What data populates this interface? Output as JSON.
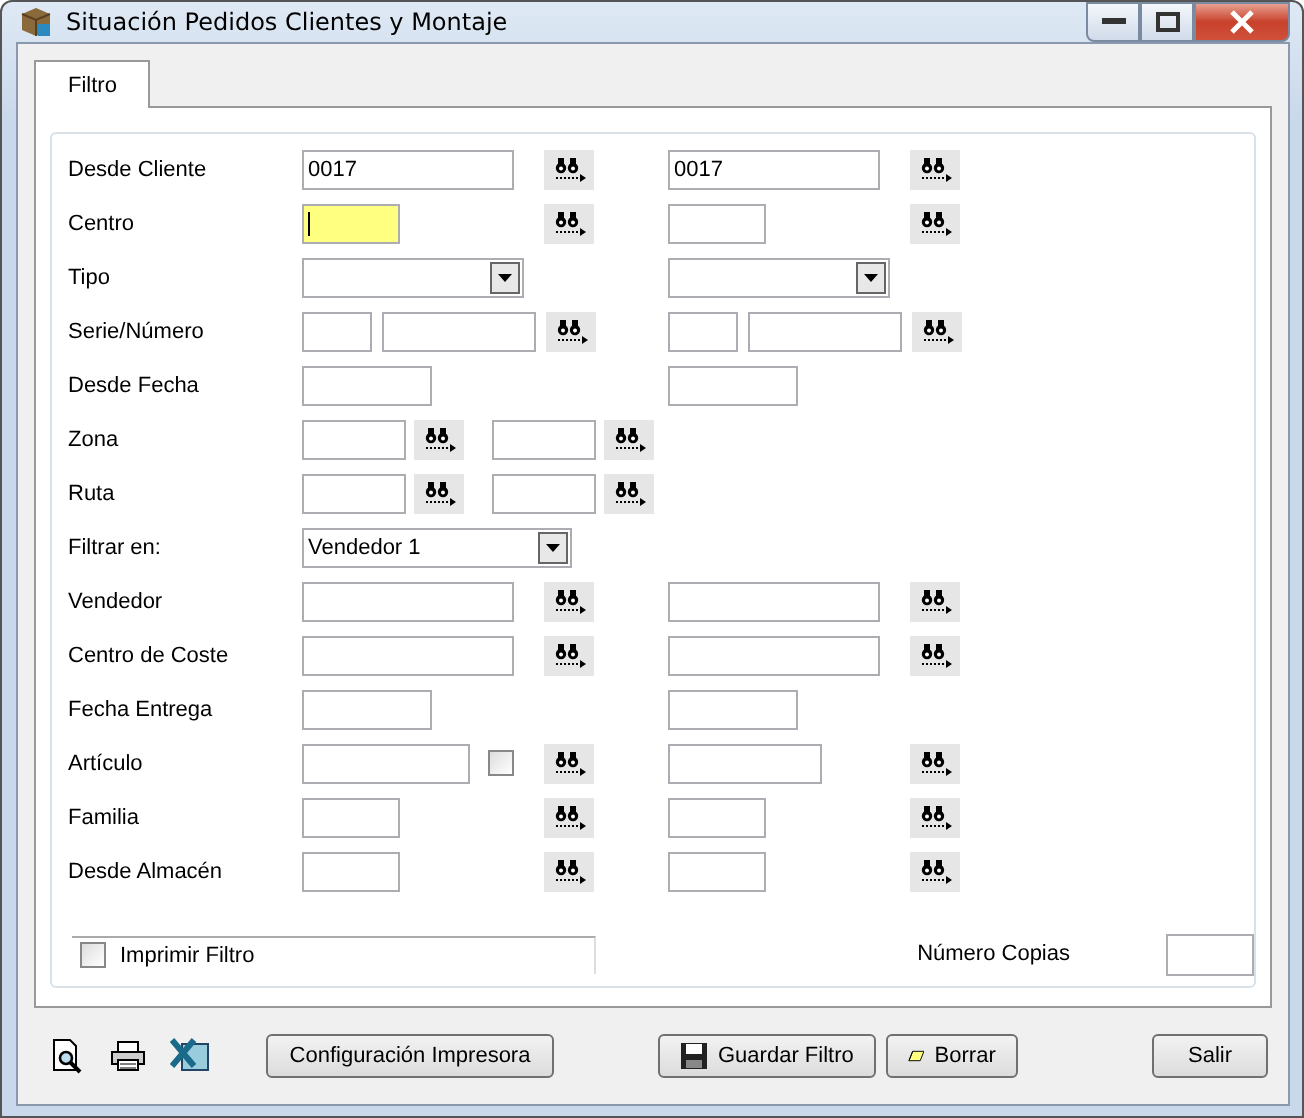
{
  "window": {
    "title": "Situación Pedidos Clientes y Montaje"
  },
  "tabs": [
    {
      "label": "Filtro",
      "selected": true
    }
  ],
  "rows": [
    {
      "label": "Desde Cliente",
      "kind": "range",
      "left": [
        {
          "kind": "long",
          "value": "0017"
        },
        {
          "kind": "lookup"
        }
      ],
      "right": [
        {
          "kind": "long",
          "value": "0017"
        },
        {
          "kind": "lookup"
        }
      ]
    },
    {
      "label": "Centro",
      "kind": "range",
      "left": [
        {
          "kind": "short",
          "focused": true
        },
        {
          "kind": "lookup"
        }
      ],
      "right": [
        {
          "kind": "short",
          "focused": false
        },
        {
          "kind": "lookup"
        }
      ]
    },
    {
      "label": "Tipo",
      "kind": "range",
      "left": [
        {
          "kind": "combo"
        }
      ],
      "right": [
        {
          "kind": "combo"
        }
      ]
    },
    {
      "label": "Serie/Número",
      "kind": "range",
      "left": [
        {
          "kind": "code"
        },
        {
          "kind": "name"
        },
        {
          "kind": "lookup"
        }
      ],
      "right": [
        {
          "kind": "code"
        },
        {
          "kind": "name"
        },
        {
          "kind": "lookup"
        }
      ]
    },
    {
      "label": "Desde Fecha",
      "kind": "range",
      "left": [
        {
          "kind": "date"
        }
      ],
      "right": [
        {
          "kind": "date"
        }
      ]
    },
    {
      "label": "Zona",
      "kind": "inline",
      "left": [
        {
          "kind": "zone"
        },
        {
          "kind": "lookup"
        },
        {
          "kind": "zone"
        },
        {
          "kind": "lookup"
        }
      ]
    },
    {
      "label": "Ruta",
      "kind": "inline",
      "left": [
        {
          "kind": "zone"
        },
        {
          "kind": "lookup"
        },
        {
          "kind": "zone"
        },
        {
          "kind": "lookup"
        }
      ]
    },
    {
      "label": "Filtrar en:",
      "kind": "inline",
      "left": [
        {
          "kind": "wide-combo",
          "value": "Vendedor 1"
        }
      ]
    },
    {
      "label": "Vendedor",
      "kind": "range",
      "left": [
        {
          "kind": "long"
        },
        {
          "kind": "lookup"
        }
      ],
      "right": [
        {
          "kind": "long"
        },
        {
          "kind": "lookup"
        }
      ]
    },
    {
      "label": "Centro de Coste",
      "kind": "range",
      "left": [
        {
          "kind": "long"
        },
        {
          "kind": "lookup"
        }
      ],
      "right": [
        {
          "kind": "long"
        },
        {
          "kind": "lookup"
        }
      ]
    },
    {
      "label": "Fecha Entrega",
      "kind": "range",
      "left": [
        {
          "kind": "date"
        }
      ],
      "right": [
        {
          "kind": "date"
        }
      ]
    },
    {
      "label": "Artículo",
      "kind": "range",
      "left": [
        {
          "kind": "article"
        },
        {
          "kind": "checkbox",
          "checked": false
        },
        {
          "kind": "lookup"
        }
      ],
      "right": [
        {
          "kind": "name"
        },
        {
          "kind": "lookup"
        }
      ]
    },
    {
      "label": "Familia",
      "kind": "range",
      "left": [
        {
          "kind": "short"
        },
        {
          "kind": "lookup"
        }
      ],
      "right": [
        {
          "kind": "short"
        },
        {
          "kind": "lookup"
        }
      ]
    },
    {
      "label": "Desde Almacén",
      "kind": "range",
      "left": [
        {
          "kind": "short"
        },
        {
          "kind": "lookup"
        }
      ],
      "right": [
        {
          "kind": "short"
        },
        {
          "kind": "lookup"
        }
      ]
    }
  ],
  "print_box": {
    "label": "Imprimir Filtro",
    "checked": false
  },
  "copies": {
    "label": "Número Copias"
  },
  "buttons": [
    {
      "label": "Configuración Impresora",
      "kind": "plain"
    },
    {
      "label": "Guardar Filtro",
      "kind": "save"
    },
    {
      "label": "Borrar",
      "kind": "erase"
    },
    {
      "label": "Salir",
      "kind": "plain"
    }
  ]
}
